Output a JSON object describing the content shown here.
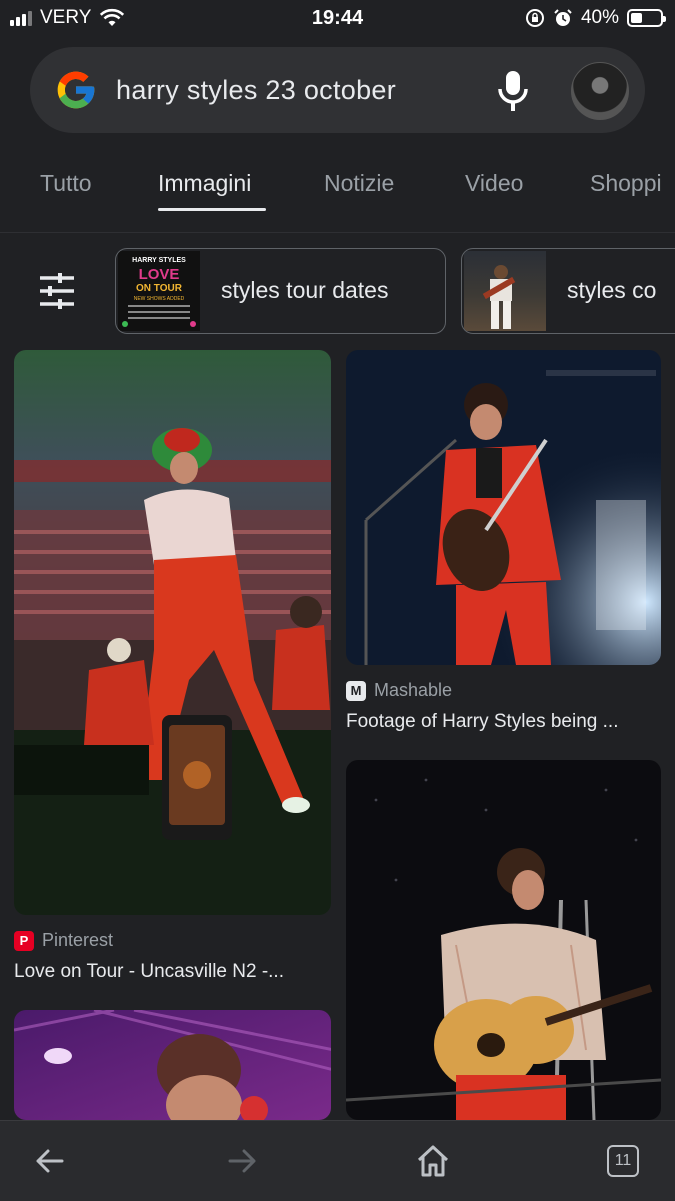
{
  "status_bar": {
    "carrier": "VERY",
    "time": "19:44",
    "battery": "40%",
    "battery_level": 0.4
  },
  "search": {
    "query": "harry styles 23 october"
  },
  "tabs": [
    {
      "label": "Tutto",
      "active": false
    },
    {
      "label": "Immagini",
      "active": true
    },
    {
      "label": "Notizie",
      "active": false
    },
    {
      "label": "Video",
      "active": false
    },
    {
      "label": "Shoppi",
      "active": false
    }
  ],
  "chips": [
    {
      "label": "styles tour dates",
      "thumb": {
        "line1": "HARRY STYLES",
        "line2": "LOVE",
        "line3": "ON TOUR",
        "line4": "NEW SHOWS ADDED"
      }
    },
    {
      "label": "styles co"
    }
  ],
  "results": [
    {
      "source": "Pinterest",
      "title": "Love on Tour - Uncasville N2 -..."
    },
    {
      "source": "Mashable",
      "title": "Footage of Harry Styles being ..."
    }
  ],
  "bottom_nav": {
    "tab_count": "11"
  },
  "colors": {
    "background": "#202124",
    "search_bg": "#303134",
    "text_primary": "#e8eaed",
    "text_secondary": "#9aa0a6",
    "pinterest": "#e60023"
  }
}
